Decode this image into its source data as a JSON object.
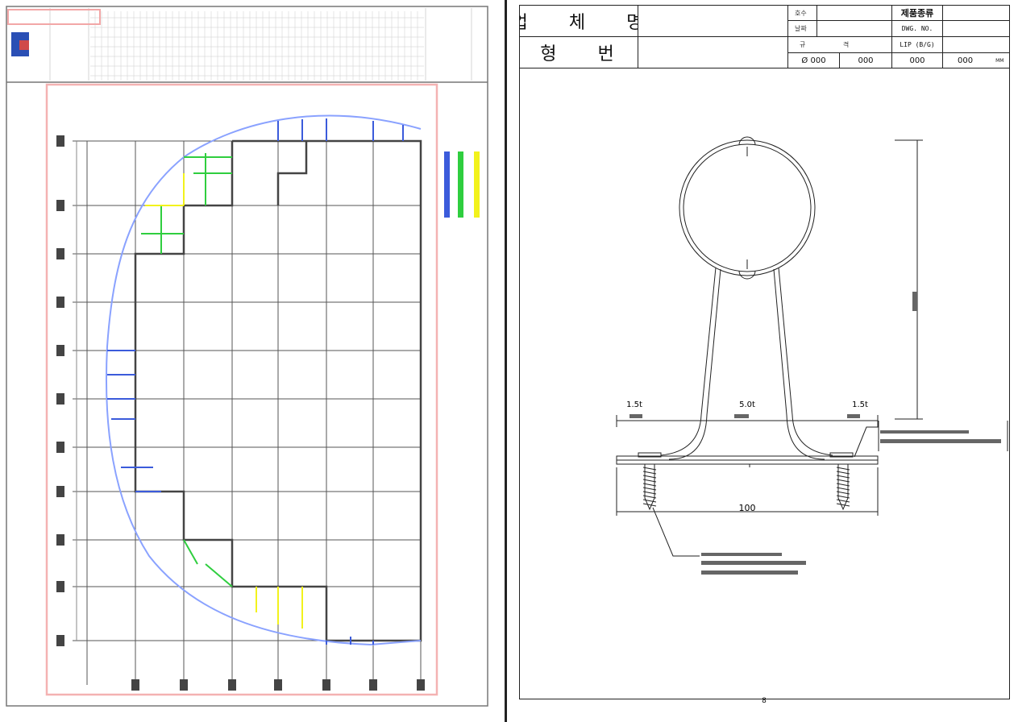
{
  "left_sheet": {
    "legend_colors": [
      "#3b5bdb",
      "#2fce3f",
      "#f2f21c"
    ]
  },
  "title_block": {
    "company_label": "업 체 명",
    "model_label": "형 번",
    "sheet_no_label": "호수",
    "date_label": "날짜",
    "spec_label": "규 격",
    "product_type_label": "제품종류",
    "dwg_no_label": "DWG. NO.",
    "product_name": "LIP (B/G)",
    "dims": [
      "Ø 000",
      "000",
      "000",
      "000"
    ],
    "unit": "MM"
  },
  "drawing": {
    "dim_left": "1.5t",
    "dim_center": "5.0t",
    "dim_right": "1.5t",
    "dim_bottom": "100",
    "page_number": "8"
  }
}
